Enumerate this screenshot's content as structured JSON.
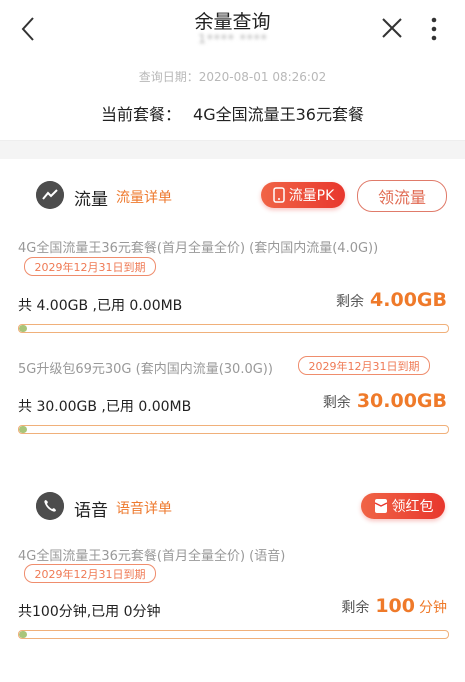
{
  "header": {
    "title": "余量查询",
    "phone": "1**** ****",
    "query_date": "查询日期：2020-08-01 08:26:02",
    "plan_label": "当前套餐：",
    "plan_name": "4G全国流量王36元套餐"
  },
  "data_section": {
    "title": "流量",
    "detail_link": "流量详单",
    "pk_button": "流量PK",
    "claim_button": "领流量",
    "items": [
      {
        "package": "4G全国流量王36元套餐(首月全量全价) (套内国内流量(4.0G))",
        "expire": "2029年12月31日到期",
        "usage": "共 4.00GB ,已用 0.00MB",
        "remain_label": "剩余",
        "remain_value": "4.00GB",
        "used_fraction": 0.0
      },
      {
        "package": "5G升级包69元30G (套内国内流量(30.0G))",
        "expire": "2029年12月31日到期",
        "usage": "共 30.00GB ,已用 0.00MB",
        "remain_label": "剩余",
        "remain_value": "30.00GB",
        "used_fraction": 0.0
      }
    ]
  },
  "voice_section": {
    "title": "语音",
    "detail_link": "语音详单",
    "redpacket_button": "领红包",
    "items": [
      {
        "package": "4G全国流量王36元套餐(首月全量全价) (语音)",
        "expire": "2029年12月31日到期",
        "usage": "共100分钟,已用 0分钟",
        "remain_label": "剩余",
        "remain_value": "100",
        "remain_unit": "分钟",
        "used_fraction": 0.0
      }
    ]
  },
  "colors": {
    "accent": "#ef7a2a",
    "red_button": "#e8372d",
    "bar_fill": "#a9c57a"
  },
  "icons": [
    "back-arrow-icon",
    "close-icon",
    "more-vertical-icon",
    "data-trend-icon",
    "phone-icon",
    "phone-pk-icon",
    "red-packet-icon"
  ]
}
